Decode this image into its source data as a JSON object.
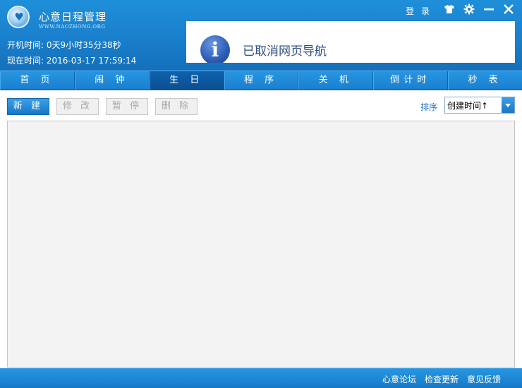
{
  "app": {
    "title": "心意日程管理",
    "site": "WWW.NAOZHONG.ORG",
    "boot_time_line": "开机时间: 0天9小时35分38秒",
    "current_time_line": "现在时间: 2016-03-17 17:59:14",
    "login_label": "登 录"
  },
  "icons": {
    "logo": "heart-logo-icon",
    "skin": "tshirt-skin-icon",
    "settings": "gear-icon",
    "minimize": "minimize-icon",
    "close": "close-icon",
    "info": "info-icon",
    "dropdown": "chevron-down-icon"
  },
  "banner": {
    "message": "已取消网页导航"
  },
  "tabs": [
    {
      "label": "首 页"
    },
    {
      "label": "闹 钟"
    },
    {
      "label": "生 日"
    },
    {
      "label": "程 序"
    },
    {
      "label": "关 机"
    },
    {
      "label": "倒计时"
    },
    {
      "label": "秒 表"
    }
  ],
  "active_tab": "生 日",
  "toolbar": {
    "new_label": "新 建",
    "edit_label": "修 改",
    "pause_label": "暂 停",
    "delete_label": "删 除",
    "sort_label": "排序",
    "sort_value": "创建时间↑"
  },
  "footer": {
    "forum": "心意论坛",
    "update": "检查更新",
    "feedback": "意见反馈"
  },
  "colors": {
    "header_blue": "#1a7fcc",
    "active_tab": "#0a4f92",
    "accent": "#1777c6"
  }
}
